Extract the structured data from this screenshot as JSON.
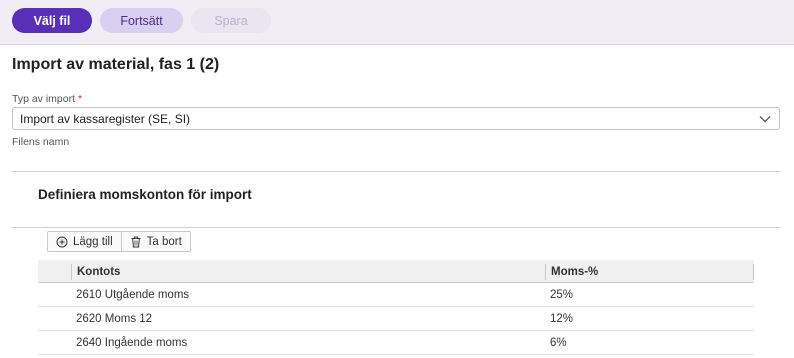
{
  "toolbar": {
    "choose_file": "Välj fil",
    "continue": "Fortsätt",
    "save": "Spara"
  },
  "page": {
    "title": "Import av material, fas 1 (2)"
  },
  "import_type": {
    "label": "Typ av import",
    "required_marker": "*",
    "value": "Import av kassaregister (SE, SI)"
  },
  "file_name": {
    "label": "Filens namn"
  },
  "vat_section": {
    "title": "Definiera momskonton för import",
    "add_label": "Lägg till",
    "remove_label": "Ta bort",
    "columns": [
      "Kontots",
      "Moms-%"
    ],
    "rows": [
      {
        "account": "2610 Utgående moms",
        "vat": "25%"
      },
      {
        "account": "2620 Moms 12",
        "vat": "12%"
      },
      {
        "account": "2640 Ingående moms",
        "vat": "6%"
      }
    ]
  },
  "colors": {
    "primary": "#5a2fb8",
    "secondary": "#d9cff0",
    "toolbar_bg": "#f0edf5"
  }
}
